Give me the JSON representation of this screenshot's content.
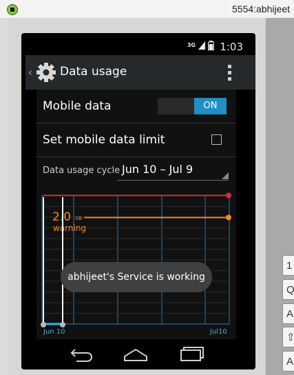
{
  "window": {
    "title": "5554:abhijeet"
  },
  "status_bar": {
    "network": "3G",
    "time": "1:03"
  },
  "action_bar": {
    "title": "Data usage"
  },
  "settings": {
    "mobile_data_label": "Mobile data",
    "mobile_data_toggle": "ON",
    "limit_label": "Set mobile data limit",
    "cycle_label": "Data usage cycle",
    "cycle_value": "Jun 10 – Jul 9"
  },
  "chart_data": {
    "type": "line",
    "x_start_label": "Jun 10",
    "x_end_label": "Jul10",
    "warning_value": "2.0",
    "warning_unit": "GB",
    "warning_label": "warning",
    "grid": true,
    "colors": {
      "warning": "#f0882a",
      "limit": "#d32f2f",
      "grid": "#2f79b8"
    }
  },
  "keyboard_keys": [
    "1",
    "Q",
    "A",
    "⇧",
    "A"
  ],
  "toast": {
    "message": "abhijeet's Service is working"
  }
}
